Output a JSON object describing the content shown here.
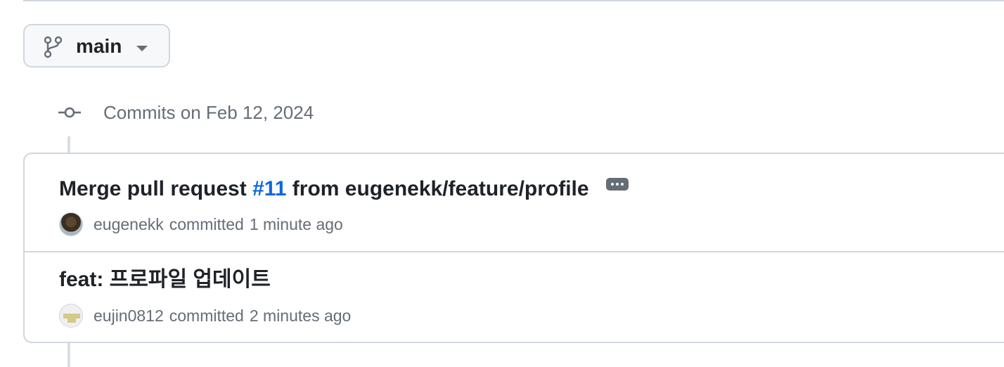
{
  "branch": {
    "name": "main"
  },
  "group": {
    "heading": "Commits on Feb 12, 2024"
  },
  "commits": [
    {
      "title_prefix": "Merge pull request ",
      "pr_link": "#11",
      "title_suffix": " from eugenekk/feature/profile",
      "author": "eugenekk",
      "verb": "committed",
      "time": "1 minute ago",
      "avatar": "dog-photo"
    },
    {
      "title": "feat: 프로파일 업데이트",
      "author": "eujin0812",
      "verb": "committed",
      "time": "2 minutes ago",
      "avatar": "identicon"
    }
  ],
  "icons": {
    "branch": "git-branch-icon",
    "caret": "triangle-down-icon",
    "commit": "git-commit-icon",
    "ellipsis": "ellipsis-icon"
  },
  "colors": {
    "link": "#0969da",
    "muted": "#656d76",
    "border": "#d0d7de"
  }
}
